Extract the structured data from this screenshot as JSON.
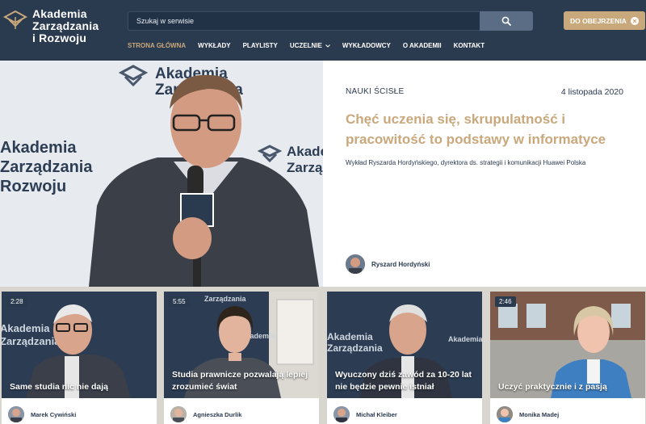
{
  "header": {
    "logo": [
      "Akademia",
      "Zarządzania",
      "i Rozwoju"
    ],
    "search_placeholder": "Szukaj w serwisie",
    "cta_label": "DO OBEJRZENIA",
    "nav": [
      {
        "label": "STRONA GŁÓWNA",
        "active": true
      },
      {
        "label": "WYKŁADY"
      },
      {
        "label": "PLAYLISTY"
      },
      {
        "label": "UCZELNIE",
        "dropdown": true
      },
      {
        "label": "WYKŁADOWCY"
      },
      {
        "label": "O AKADEMII"
      },
      {
        "label": "KONTAKT"
      }
    ]
  },
  "hero": {
    "category": "NAUKI ŚCISŁE",
    "date": "4 listopada 2020",
    "title": "Chęć uczenia się, skrupulatność i pracowitość to podstawy w informatyce",
    "subtitle": "Wykład Ryszarda Hordyńskiego, dyrektora ds. strategii i komunikacji Huawei Polska",
    "author": "Ryszard Hordyński",
    "backdrop_text": [
      "Akademia",
      "Zarządzania",
      "Rozwoju"
    ]
  },
  "cards": [
    {
      "duration": "2:28",
      "title": "Same studia nic nie dają",
      "author": "Marek Cywiński"
    },
    {
      "duration": "5:55",
      "title": "Studia prawnicze pozwalają lepiej zrozumieć świat",
      "author": "Agnieszka Durlik"
    },
    {
      "duration": "",
      "title": "Wyuczony dziś zawód za 10-20 lat nie będzie pewnie istniał",
      "author": "Michał Kleiber"
    },
    {
      "duration": "2:46",
      "title": "Uczyć praktycznie i z pasją",
      "author": "Monika Madej"
    }
  ],
  "colors": {
    "navy": "#2a3a4f",
    "gold": "#c9a87c"
  }
}
